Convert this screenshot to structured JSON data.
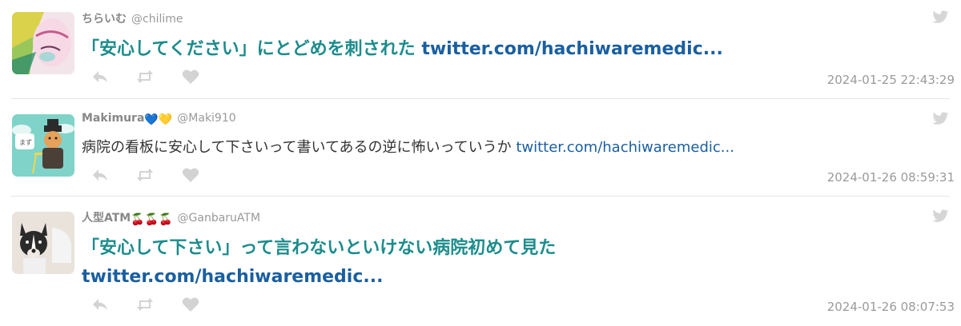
{
  "icons": {
    "reply": "reply-icon",
    "retweet": "retweet-icon",
    "like": "heart-icon",
    "service": "twitter-bird-icon"
  },
  "colors": {
    "big_text": "#1c8c8c",
    "link": "#1a5fa0",
    "meta": "#999999",
    "icon": "#d0d0d0"
  },
  "tweets": [
    {
      "name": "ちらいむ",
      "handle": "@chilime",
      "text": "「安心してください」にとどめを刺された ",
      "link": "twitter.com/hachiwaremedic...",
      "timestamp": "2024-01-25 22:43:29"
    },
    {
      "name": "Makimura",
      "name_emoji": "💙💛",
      "handle": "@Maki910",
      "text": "病院の看板に安心して下さいって書いてあるの逆に怖いっていうか ",
      "link": "twitter.com/hachiwaremedic...",
      "timestamp": "2024-01-26 08:59:31"
    },
    {
      "name": "人型ATM",
      "name_emoji": "🍒🍒🍒",
      "handle": "@GanbaruATM",
      "text": "「安心して下さい」って言わないといけない病院初めて見た",
      "link": "twitter.com/hachiwaremedic...",
      "timestamp": "2024-01-26 08:07:53"
    }
  ]
}
